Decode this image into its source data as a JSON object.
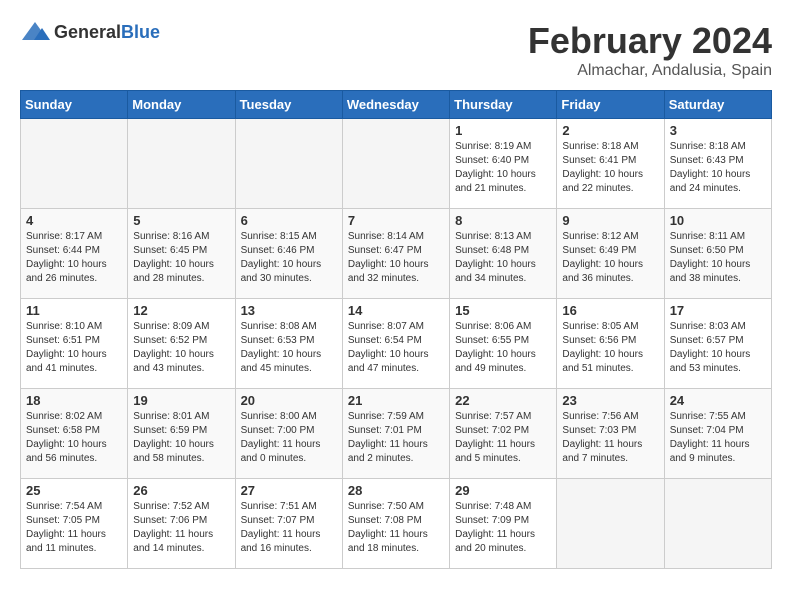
{
  "header": {
    "logo_general": "General",
    "logo_blue": "Blue",
    "month_year": "February 2024",
    "location": "Almachar, Andalusia, Spain"
  },
  "days_of_week": [
    "Sunday",
    "Monday",
    "Tuesday",
    "Wednesday",
    "Thursday",
    "Friday",
    "Saturday"
  ],
  "weeks": [
    [
      {
        "day": "",
        "info": ""
      },
      {
        "day": "",
        "info": ""
      },
      {
        "day": "",
        "info": ""
      },
      {
        "day": "",
        "info": ""
      },
      {
        "day": "1",
        "info": "Sunrise: 8:19 AM\nSunset: 6:40 PM\nDaylight: 10 hours\nand 21 minutes."
      },
      {
        "day": "2",
        "info": "Sunrise: 8:18 AM\nSunset: 6:41 PM\nDaylight: 10 hours\nand 22 minutes."
      },
      {
        "day": "3",
        "info": "Sunrise: 8:18 AM\nSunset: 6:43 PM\nDaylight: 10 hours\nand 24 minutes."
      }
    ],
    [
      {
        "day": "4",
        "info": "Sunrise: 8:17 AM\nSunset: 6:44 PM\nDaylight: 10 hours\nand 26 minutes."
      },
      {
        "day": "5",
        "info": "Sunrise: 8:16 AM\nSunset: 6:45 PM\nDaylight: 10 hours\nand 28 minutes."
      },
      {
        "day": "6",
        "info": "Sunrise: 8:15 AM\nSunset: 6:46 PM\nDaylight: 10 hours\nand 30 minutes."
      },
      {
        "day": "7",
        "info": "Sunrise: 8:14 AM\nSunset: 6:47 PM\nDaylight: 10 hours\nand 32 minutes."
      },
      {
        "day": "8",
        "info": "Sunrise: 8:13 AM\nSunset: 6:48 PM\nDaylight: 10 hours\nand 34 minutes."
      },
      {
        "day": "9",
        "info": "Sunrise: 8:12 AM\nSunset: 6:49 PM\nDaylight: 10 hours\nand 36 minutes."
      },
      {
        "day": "10",
        "info": "Sunrise: 8:11 AM\nSunset: 6:50 PM\nDaylight: 10 hours\nand 38 minutes."
      }
    ],
    [
      {
        "day": "11",
        "info": "Sunrise: 8:10 AM\nSunset: 6:51 PM\nDaylight: 10 hours\nand 41 minutes."
      },
      {
        "day": "12",
        "info": "Sunrise: 8:09 AM\nSunset: 6:52 PM\nDaylight: 10 hours\nand 43 minutes."
      },
      {
        "day": "13",
        "info": "Sunrise: 8:08 AM\nSunset: 6:53 PM\nDaylight: 10 hours\nand 45 minutes."
      },
      {
        "day": "14",
        "info": "Sunrise: 8:07 AM\nSunset: 6:54 PM\nDaylight: 10 hours\nand 47 minutes."
      },
      {
        "day": "15",
        "info": "Sunrise: 8:06 AM\nSunset: 6:55 PM\nDaylight: 10 hours\nand 49 minutes."
      },
      {
        "day": "16",
        "info": "Sunrise: 8:05 AM\nSunset: 6:56 PM\nDaylight: 10 hours\nand 51 minutes."
      },
      {
        "day": "17",
        "info": "Sunrise: 8:03 AM\nSunset: 6:57 PM\nDaylight: 10 hours\nand 53 minutes."
      }
    ],
    [
      {
        "day": "18",
        "info": "Sunrise: 8:02 AM\nSunset: 6:58 PM\nDaylight: 10 hours\nand 56 minutes."
      },
      {
        "day": "19",
        "info": "Sunrise: 8:01 AM\nSunset: 6:59 PM\nDaylight: 10 hours\nand 58 minutes."
      },
      {
        "day": "20",
        "info": "Sunrise: 8:00 AM\nSunset: 7:00 PM\nDaylight: 11 hours\nand 0 minutes."
      },
      {
        "day": "21",
        "info": "Sunrise: 7:59 AM\nSunset: 7:01 PM\nDaylight: 11 hours\nand 2 minutes."
      },
      {
        "day": "22",
        "info": "Sunrise: 7:57 AM\nSunset: 7:02 PM\nDaylight: 11 hours\nand 5 minutes."
      },
      {
        "day": "23",
        "info": "Sunrise: 7:56 AM\nSunset: 7:03 PM\nDaylight: 11 hours\nand 7 minutes."
      },
      {
        "day": "24",
        "info": "Sunrise: 7:55 AM\nSunset: 7:04 PM\nDaylight: 11 hours\nand 9 minutes."
      }
    ],
    [
      {
        "day": "25",
        "info": "Sunrise: 7:54 AM\nSunset: 7:05 PM\nDaylight: 11 hours\nand 11 minutes."
      },
      {
        "day": "26",
        "info": "Sunrise: 7:52 AM\nSunset: 7:06 PM\nDaylight: 11 hours\nand 14 minutes."
      },
      {
        "day": "27",
        "info": "Sunrise: 7:51 AM\nSunset: 7:07 PM\nDaylight: 11 hours\nand 16 minutes."
      },
      {
        "day": "28",
        "info": "Sunrise: 7:50 AM\nSunset: 7:08 PM\nDaylight: 11 hours\nand 18 minutes."
      },
      {
        "day": "29",
        "info": "Sunrise: 7:48 AM\nSunset: 7:09 PM\nDaylight: 11 hours\nand 20 minutes."
      },
      {
        "day": "",
        "info": ""
      },
      {
        "day": "",
        "info": ""
      }
    ]
  ]
}
